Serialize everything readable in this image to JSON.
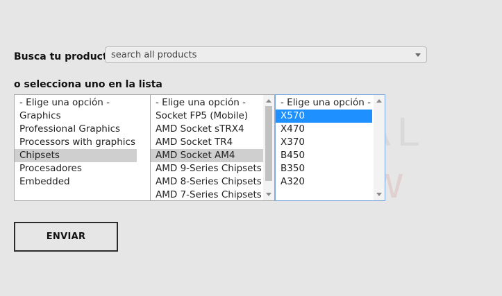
{
  "watermark": {
    "line1": "PROFESIONAL",
    "line2": "review"
  },
  "search": {
    "label": "Busca tu producto",
    "value": "search all products"
  },
  "list": {
    "label": "o selecciona uno en la lista",
    "category": {
      "options": [
        "- Elige una opción -",
        "Graphics",
        "Professional Graphics",
        "Processors with graphics",
        "Chipsets",
        "Procesadores",
        "Embedded"
      ],
      "selected": "Chipsets"
    },
    "subcategory": {
      "options": [
        "- Elige una opción -",
        "Socket FP5 (Mobile)",
        "AMD Socket sTRX4",
        "AMD Socket TR4",
        "AMD Socket AM4",
        "AMD 9-Series Chipsets",
        "AMD 8-Series Chipsets",
        "AMD 7-Series Chipsets"
      ],
      "selected": "AMD Socket AM4"
    },
    "chipset": {
      "options": [
        "- Elige una opción -",
        "X570",
        "X470",
        "X370",
        "B450",
        "B350",
        "A320"
      ],
      "selected": "X570"
    }
  },
  "submit": {
    "label": "ENVIAR"
  },
  "colors": {
    "background": "#e6e6e6",
    "selection_blue": "#1e90ff",
    "selection_gray": "#cfcfcf"
  }
}
